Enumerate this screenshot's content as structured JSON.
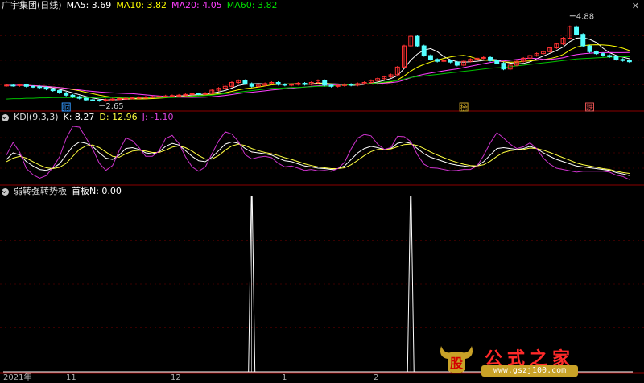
{
  "main": {
    "title": "广宇集团(日线)",
    "ma5": "MA5: 3.69",
    "ma10": "MA10: 3.82",
    "ma20": "MA20: 4.05",
    "ma60": "MA60: 3.82",
    "high_label": "4.88",
    "low_label": "2.65",
    "event_labels": [
      "财",
      "榜",
      "跌"
    ]
  },
  "kdj": {
    "title": "KDJ(9,3,3)",
    "k": "K: 8.27",
    "d": "D: 12.96",
    "j": "J: -1.10"
  },
  "sub": {
    "title": "弱转强转势板",
    "value": "首板N: 0.00"
  },
  "date_axis": [
    "2021年",
    "11",
    "12",
    "1",
    "2"
  ],
  "watermark": {
    "logo_text": "股",
    "title": "公式之家",
    "url": "www.gszj100.com"
  },
  "colors": {
    "up": "#ff3232",
    "down": "#54ffff",
    "ma5": "#ffffff",
    "ma10": "#ffff00",
    "ma20": "#ff40ff",
    "ma60": "#00c000",
    "k": "#ffffff",
    "d": "#ffff40",
    "j": "#cc33cc",
    "grid": "#8b0000"
  },
  "chart_data": [
    {
      "type": "candlestick",
      "title": "广宇集团(日线)",
      "ylim": [
        2.45,
        5.0
      ],
      "annotations": [
        {
          "text": "4.88",
          "value": 4.88
        },
        {
          "text": "2.65",
          "value": 2.65
        }
      ],
      "close": [
        3.08,
        3.07,
        3.09,
        3.05,
        3.04,
        3.02,
        2.98,
        2.94,
        2.88,
        2.82,
        2.78,
        2.74,
        2.7,
        2.69,
        2.68,
        2.7,
        2.72,
        2.73,
        2.74,
        2.75,
        2.76,
        2.77,
        2.78,
        2.79,
        2.8,
        2.81,
        2.82,
        2.84,
        2.86,
        2.85,
        2.87,
        2.95,
        3.0,
        3.05,
        3.15,
        3.2,
        3.12,
        3.05,
        3.08,
        3.12,
        3.15,
        3.1,
        3.08,
        3.1,
        3.13,
        3.1,
        3.15,
        3.2,
        3.08,
        3.05,
        3.07,
        3.1,
        3.08,
        3.12,
        3.15,
        3.2,
        3.25,
        3.3,
        3.35,
        3.55,
        4.1,
        4.35,
        4.1,
        3.85,
        3.75,
        3.7,
        3.72,
        3.68,
        3.6,
        3.7,
        3.75,
        3.78,
        3.8,
        3.72,
        3.65,
        3.5,
        3.6,
        3.7,
        3.78,
        3.85,
        3.9,
        3.95,
        4.05,
        4.15,
        4.3,
        4.6,
        4.4,
        4.1,
        3.95,
        3.9,
        3.85,
        3.82,
        3.75,
        3.72,
        3.69
      ],
      "open": [
        3.07,
        3.08,
        3.07,
        3.09,
        3.05,
        3.04,
        3.02,
        2.98,
        2.94,
        2.88,
        2.82,
        2.78,
        2.74,
        2.7,
        2.69,
        2.68,
        2.7,
        2.72,
        2.73,
        2.74,
        2.75,
        2.76,
        2.77,
        2.78,
        2.79,
        2.8,
        2.81,
        2.82,
        2.84,
        2.86,
        2.85,
        2.87,
        2.95,
        3.0,
        3.05,
        3.15,
        3.2,
        3.12,
        3.05,
        3.08,
        3.12,
        3.15,
        3.1,
        3.08,
        3.1,
        3.13,
        3.1,
        3.15,
        3.2,
        3.08,
        3.05,
        3.07,
        3.1,
        3.08,
        3.12,
        3.15,
        3.2,
        3.25,
        3.3,
        3.35,
        3.55,
        4.1,
        4.35,
        4.1,
        3.85,
        3.75,
        3.7,
        3.72,
        3.68,
        3.6,
        3.7,
        3.75,
        3.78,
        3.8,
        3.72,
        3.65,
        3.5,
        3.6,
        3.7,
        3.78,
        3.85,
        3.9,
        3.95,
        4.05,
        4.15,
        4.3,
        4.6,
        4.4,
        4.1,
        3.95,
        3.9,
        3.85,
        3.82,
        3.75,
        3.72
      ],
      "ma60": [
        2.72,
        2.73,
        2.73,
        2.74,
        2.74,
        2.75,
        2.75,
        2.76,
        2.76,
        2.76,
        2.76,
        2.76,
        2.76,
        2.76,
        2.76,
        2.76,
        2.76,
        2.76,
        2.76,
        2.76,
        2.76,
        2.76,
        2.76,
        2.76,
        2.76,
        2.76,
        2.77,
        2.78,
        2.79,
        2.8,
        2.81,
        2.82,
        2.84,
        2.86,
        2.88,
        2.9,
        2.92,
        2.94,
        2.96,
        2.98,
        3.0,
        3.0,
        3.01,
        3.02,
        3.02,
        3.03,
        3.04,
        3.05,
        3.05,
        3.06,
        3.07,
        3.08,
        3.09,
        3.1,
        3.11,
        3.12,
        3.14,
        3.16,
        3.18,
        3.2,
        3.24,
        3.28,
        3.3,
        3.32,
        3.34,
        3.36,
        3.38,
        3.4,
        3.42,
        3.44,
        3.46,
        3.48,
        3.5,
        3.52,
        3.53,
        3.54,
        3.56,
        3.58,
        3.6,
        3.62,
        3.64,
        3.66,
        3.68,
        3.7,
        3.72,
        3.74,
        3.76,
        3.77,
        3.78,
        3.79,
        3.8,
        3.81,
        3.81,
        3.82,
        3.82
      ]
    },
    {
      "type": "line",
      "title": "KDJ(9,3,3)",
      "series": [
        {
          "name": "K",
          "values": [
            45,
            60,
            55,
            40,
            30,
            22,
            20,
            25,
            35,
            55,
            75,
            85,
            82,
            75,
            60,
            48,
            45,
            55,
            70,
            72,
            68,
            60,
            58,
            62,
            75,
            82,
            78,
            65,
            52,
            42,
            40,
            50,
            65,
            80,
            85,
            82,
            70,
            62,
            60,
            58,
            55,
            48,
            42,
            40,
            35,
            30,
            28,
            25,
            24,
            22,
            24,
            30,
            45,
            60,
            70,
            75,
            72,
            68,
            70,
            82,
            85,
            82,
            70,
            58,
            50,
            45,
            40,
            35,
            32,
            30,
            28,
            30,
            40,
            55,
            70,
            72,
            70,
            68,
            70,
            75,
            70,
            60,
            52,
            45,
            40,
            35,
            30,
            28,
            26,
            24,
            22,
            20,
            15,
            12,
            8.27
          ]
        },
        {
          "name": "D",
          "values": [
            40,
            48,
            52,
            48,
            40,
            32,
            26,
            24,
            27,
            36,
            52,
            68,
            76,
            78,
            72,
            62,
            52,
            50,
            58,
            64,
            66,
            64,
            61,
            61,
            66,
            73,
            76,
            72,
            64,
            54,
            46,
            46,
            54,
            66,
            76,
            80,
            77,
            70,
            65,
            61,
            58,
            54,
            49,
            45,
            40,
            35,
            31,
            28,
            26,
            24,
            24,
            26,
            33,
            43,
            54,
            63,
            68,
            68,
            69,
            74,
            79,
            80,
            77,
            70,
            62,
            55,
            49,
            43,
            38,
            34,
            31,
            30,
            33,
            41,
            52,
            61,
            65,
            67,
            68,
            71,
            70,
            66,
            61,
            55,
            49,
            43,
            37,
            33,
            30,
            27,
            24,
            22,
            18,
            15,
            12.96
          ]
        },
        {
          "name": "J",
          "values": [
            55,
            84,
            61,
            24,
            10,
            2,
            8,
            27,
            51,
            93,
            121,
            119,
            94,
            69,
            36,
            20,
            31,
            65,
            94,
            88,
            72,
            52,
            52,
            64,
            93,
            100,
            82,
            51,
            28,
            18,
            28,
            58,
            87,
            108,
            103,
            86,
            56,
            46,
            50,
            52,
            49,
            36,
            28,
            30,
            25,
            20,
            22,
            19,
            20,
            18,
            24,
            38,
            69,
            94,
            102,
            99,
            80,
            68,
            72,
            98,
            97,
            86,
            56,
            34,
            26,
            25,
            22,
            19,
            20,
            22,
            22,
            30,
            54,
            83,
            106,
            94,
            80,
            70,
            74,
            83,
            70,
            48,
            34,
            25,
            22,
            19,
            16,
            18,
            18,
            18,
            18,
            16,
            9,
            6,
            -1.1
          ]
        }
      ]
    },
    {
      "type": "line",
      "title": "弱转强转势板",
      "series": [
        {
          "name": "首板N",
          "values": [
            0,
            0,
            0,
            0,
            0,
            0,
            0,
            0,
            0,
            0,
            0,
            0,
            0,
            0,
            0,
            0,
            0,
            0,
            0,
            0,
            0,
            0,
            0,
            0,
            0,
            0,
            0,
            0,
            0,
            0,
            0,
            0,
            0,
            0,
            0,
            0,
            0,
            1,
            0,
            0,
            0,
            0,
            0,
            0,
            0,
            0,
            0,
            0,
            0,
            0,
            0,
            0,
            0,
            0,
            0,
            0,
            0,
            0,
            0,
            0,
            0,
            1,
            0,
            0,
            0,
            0,
            0,
            0,
            0,
            0,
            0,
            0,
            0,
            0,
            0,
            0,
            0,
            0,
            0,
            0,
            0,
            0,
            0,
            0,
            0,
            0,
            0,
            0,
            0,
            0,
            0,
            0,
            0,
            0,
            0.0
          ]
        }
      ]
    }
  ]
}
